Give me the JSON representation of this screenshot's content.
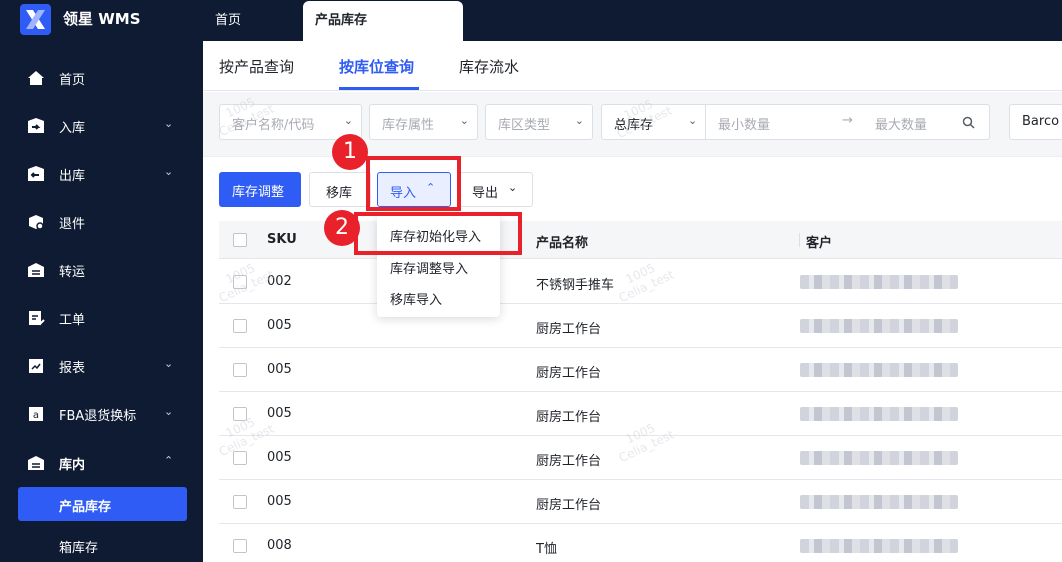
{
  "app": {
    "brand": "领星 WMS",
    "accent": "#2f5cf5",
    "nav_bg": "#0f1b33",
    "annotation": "#e8212a"
  },
  "top_tabs": [
    {
      "label": "首页"
    },
    {
      "label": "产品库存"
    }
  ],
  "sidebar": {
    "items": [
      {
        "label": "首页",
        "icon": "home-icon",
        "expand": ""
      },
      {
        "label": "入库",
        "icon": "inbound-icon",
        "expand": "⌄"
      },
      {
        "label": "出库",
        "icon": "outbound-icon",
        "expand": "⌄"
      },
      {
        "label": "退件",
        "icon": "return-icon",
        "expand": ""
      },
      {
        "label": "转运",
        "icon": "transfer-icon",
        "expand": ""
      },
      {
        "label": "工单",
        "icon": "workorder-icon",
        "expand": ""
      },
      {
        "label": "报表",
        "icon": "report-icon",
        "expand": "⌄"
      },
      {
        "label": "FBA退货换标",
        "icon": "fba-icon",
        "expand": "⌄"
      },
      {
        "label": "库内",
        "icon": "warehouse-icon",
        "expand": "⌃"
      }
    ],
    "sub_items": [
      {
        "label": "产品库存"
      },
      {
        "label": "箱库存"
      }
    ]
  },
  "sub_tabs": [
    {
      "label": "按产品查询"
    },
    {
      "label": "按库位查询"
    },
    {
      "label": "库存流水"
    }
  ],
  "filters": {
    "customer": "客户名称/代码",
    "attribute": "库存属性",
    "zone_type": "库区类型",
    "stock_type": "总库存",
    "min_qty": "最小数量",
    "arrow": "→",
    "max_qty": "最大数量",
    "barcode": "Barco"
  },
  "toolbar": {
    "adjust": "库存调整",
    "move": "移库",
    "import": "导入",
    "export": "导出"
  },
  "import_menu": [
    {
      "label": "库存初始化导入"
    },
    {
      "label": "库存调整导入"
    },
    {
      "label": "移库导入"
    }
  ],
  "annotations": {
    "step1": "1",
    "step2": "2"
  },
  "table": {
    "headers": {
      "sku": "SKU",
      "product": "产品名称",
      "customer": "客户"
    },
    "rows": [
      {
        "sku": "002",
        "product": "不锈钢手推车"
      },
      {
        "sku": "005",
        "product": "厨房工作台"
      },
      {
        "sku": "005",
        "product": "厨房工作台"
      },
      {
        "sku": "005",
        "product": "厨房工作台"
      },
      {
        "sku": "005",
        "product": "厨房工作台"
      },
      {
        "sku": "005",
        "product": "厨房工作台"
      },
      {
        "sku": "008",
        "product": "T恤"
      }
    ]
  },
  "watermark": {
    "line1": "1005",
    "line2": "Celia_test"
  }
}
